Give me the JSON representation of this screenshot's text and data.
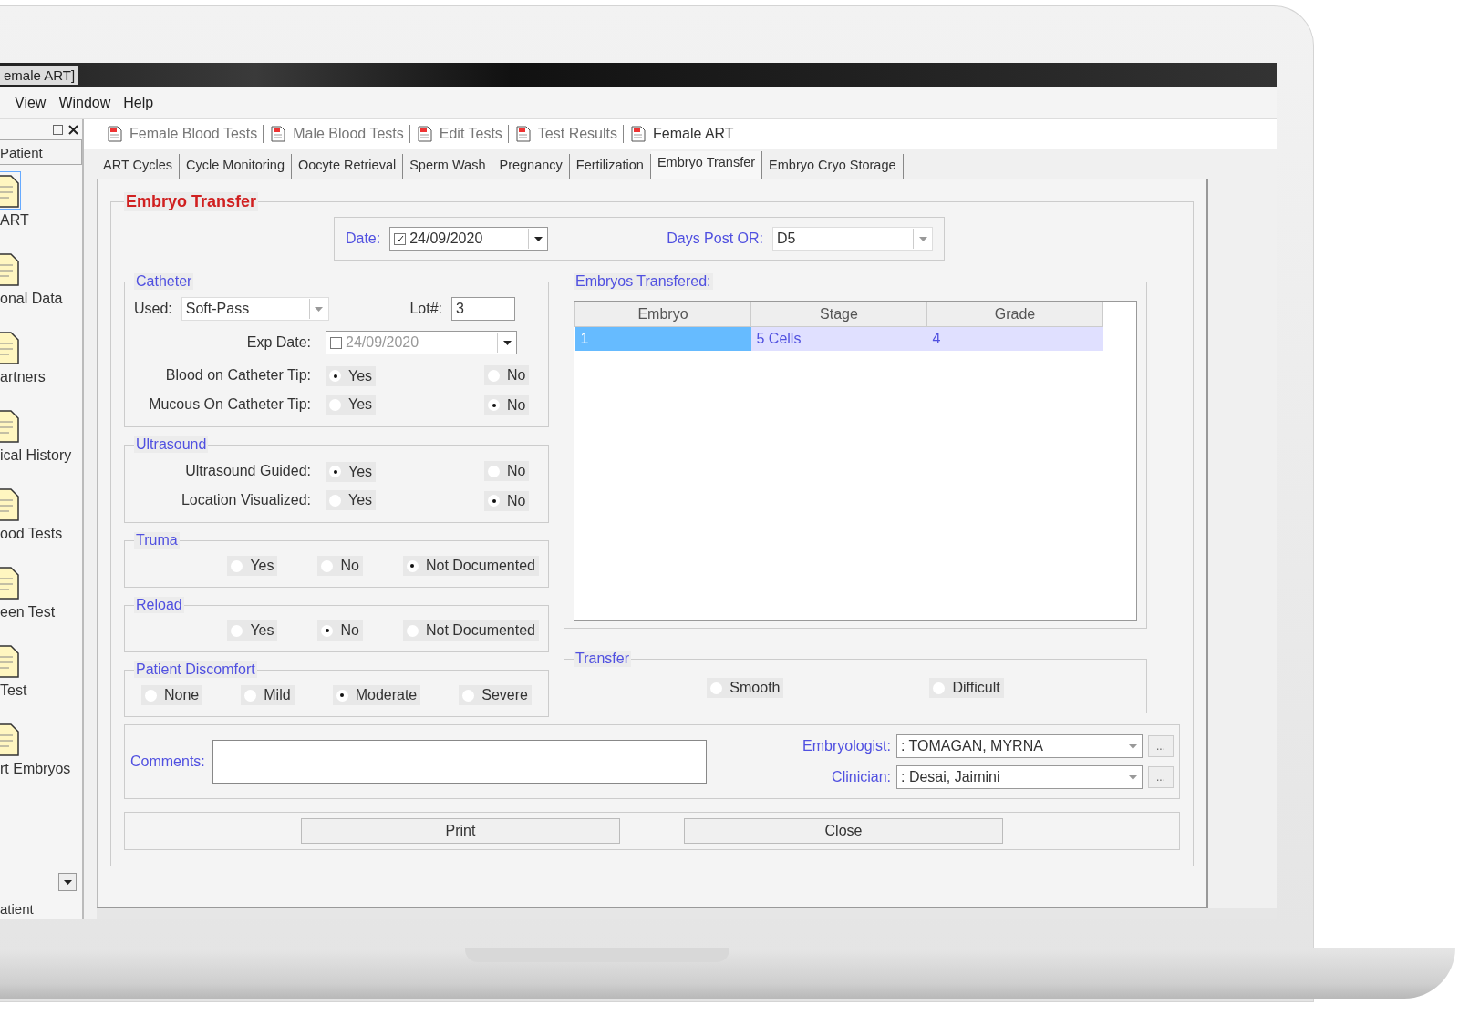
{
  "window": {
    "title": "emale ART]"
  },
  "menu": [
    "View",
    "Window",
    "Help"
  ],
  "sidebar": {
    "header": "Patient",
    "items": [
      {
        "label": "ART",
        "selected": true
      },
      {
        "label": "onal Data",
        "selected": false
      },
      {
        "label": "artners",
        "selected": false
      },
      {
        "label": "ical History",
        "selected": false
      },
      {
        "label": "ood Tests",
        "selected": false
      },
      {
        "label": "een Test",
        "selected": false
      },
      {
        "label": "Test",
        "selected": false
      },
      {
        "label": "rt Embryos",
        "selected": false
      }
    ],
    "footer": "atient"
  },
  "toolbar": [
    "Female Blood Tests",
    "Male Blood Tests",
    "Edit Tests",
    "Test Results",
    "Female ART"
  ],
  "tabs": [
    {
      "label": "ART Cycles",
      "selected": false
    },
    {
      "label": "Cycle Monitoring",
      "selected": false
    },
    {
      "label": "Oocyte Retrieval",
      "selected": false
    },
    {
      "label": "Sperm Wash",
      "selected": false
    },
    {
      "label": "Pregnancy",
      "selected": false
    },
    {
      "label": "Fertilization",
      "selected": false
    },
    {
      "label": "Embryo Transfer",
      "selected": true
    },
    {
      "label": "Embryo Cryo Storage",
      "selected": false
    }
  ],
  "form": {
    "title": "Embryo Transfer",
    "date": {
      "label": "Date:",
      "checked": true,
      "value": "24/09/2020"
    },
    "days_post_or": {
      "label": "Days Post OR:",
      "value": "D5"
    },
    "catheter": {
      "legend": "Catheter",
      "used_label": "Used:",
      "used": "Soft-Pass",
      "lot_label": "Lot#:",
      "lot": "3",
      "exp_label": "Exp Date:",
      "exp_checked": false,
      "exp_date": "24/09/2020",
      "questions": [
        {
          "label": "Blood on Catheter Tip:",
          "options": [
            {
              "label": "Yes",
              "selected": true
            },
            {
              "label": "No",
              "selected": false
            }
          ]
        },
        {
          "label": "Mucous On Catheter Tip:",
          "options": [
            {
              "label": "Yes",
              "selected": false
            },
            {
              "label": "No",
              "selected": true
            }
          ]
        }
      ]
    },
    "ultrasound": {
      "legend": "Ultrasound",
      "questions": [
        {
          "label": "Ultrasound Guided:",
          "options": [
            {
              "label": "Yes",
              "selected": true
            },
            {
              "label": "No",
              "selected": false
            }
          ]
        },
        {
          "label": "Location Visualized:",
          "options": [
            {
              "label": "Yes",
              "selected": false
            },
            {
              "label": "No",
              "selected": true
            }
          ]
        }
      ]
    },
    "truma": {
      "legend": "Truma",
      "options": [
        {
          "label": "Yes",
          "selected": false
        },
        {
          "label": "No",
          "selected": false
        },
        {
          "label": "Not Documented",
          "selected": true
        }
      ]
    },
    "reload": {
      "legend": "Reload",
      "options": [
        {
          "label": "Yes",
          "selected": false
        },
        {
          "label": "No",
          "selected": true
        },
        {
          "label": "Not Documented",
          "selected": false
        }
      ]
    },
    "discomfort": {
      "legend": "Patient Discomfort",
      "options": [
        {
          "label": "None",
          "selected": false
        },
        {
          "label": "Mild",
          "selected": false
        },
        {
          "label": "Moderate",
          "selected": true
        },
        {
          "label": "Severe",
          "selected": false
        }
      ]
    },
    "embryos": {
      "legend": "Embryos Transfered:",
      "columns": [
        "Embryo",
        "Stage",
        "Grade"
      ],
      "rows": [
        {
          "cells": [
            "1",
            "5 Cells",
            "4"
          ],
          "selected": true
        }
      ]
    },
    "transfer": {
      "legend": "Transfer",
      "options": [
        {
          "label": "Smooth",
          "selected": false
        },
        {
          "label": "Difficult",
          "selected": false
        }
      ]
    },
    "comments": {
      "label": "Comments:"
    },
    "embryologist": {
      "label": "Embryologist:",
      "value": ": TOMAGAN, MYRNA",
      "button": "..."
    },
    "clinician": {
      "label": "Clinician:",
      "value": ": Desai, Jaimini",
      "button": "..."
    },
    "buttons": [
      "Print",
      "Close"
    ]
  }
}
